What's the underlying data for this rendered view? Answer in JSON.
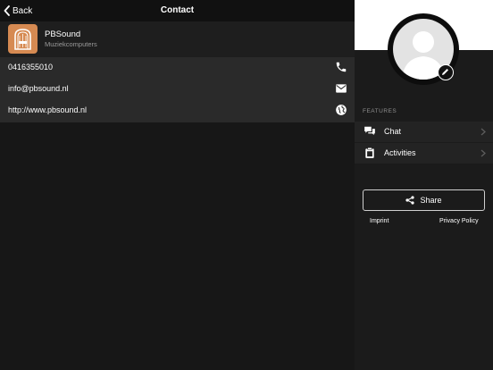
{
  "topbar": {
    "back_label": "Back",
    "title": "Contact"
  },
  "business": {
    "name": "PBSound",
    "subtitle": "Muziekcomputers",
    "logo_color": "#d68a52"
  },
  "contacts": [
    {
      "value": "0416355010",
      "icon": "phone-icon"
    },
    {
      "value": "info@pbsound.nl",
      "icon": "mail-icon"
    },
    {
      "value": "http://www.pbsound.nl",
      "icon": "globe-icon"
    }
  ],
  "profile": {
    "avatar_icon": "user-silhouette-icon",
    "edit_icon": "pencil-icon"
  },
  "features": {
    "section_label": "FEATURES",
    "items": [
      {
        "label": "Chat",
        "icon": "chat-bubbles-icon"
      },
      {
        "label": "Activities",
        "icon": "clipboard-icon"
      }
    ]
  },
  "share": {
    "label": "Share",
    "icon": "share-icon"
  },
  "footer": {
    "imprint": "Imprint",
    "privacy": "Privacy Policy"
  }
}
